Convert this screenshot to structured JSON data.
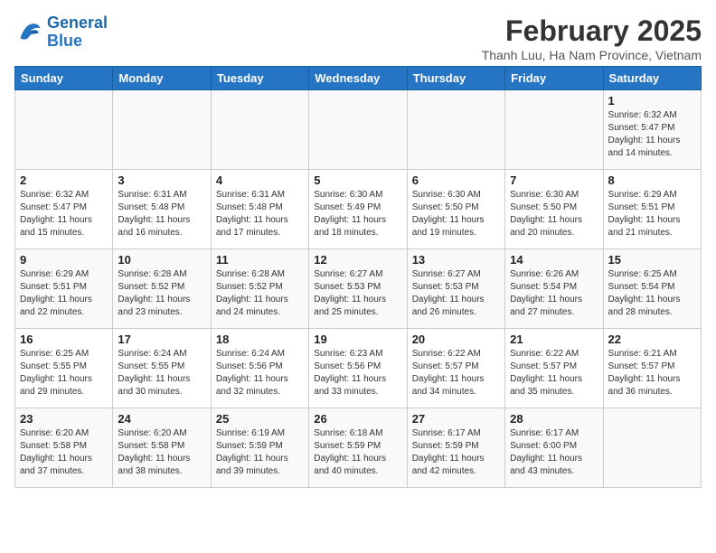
{
  "logo": {
    "line1": "General",
    "line2": "Blue"
  },
  "title": "February 2025",
  "subtitle": "Thanh Luu, Ha Nam Province, Vietnam",
  "days_of_week": [
    "Sunday",
    "Monday",
    "Tuesday",
    "Wednesday",
    "Thursday",
    "Friday",
    "Saturday"
  ],
  "weeks": [
    [
      {
        "day": "",
        "info": ""
      },
      {
        "day": "",
        "info": ""
      },
      {
        "day": "",
        "info": ""
      },
      {
        "day": "",
        "info": ""
      },
      {
        "day": "",
        "info": ""
      },
      {
        "day": "",
        "info": ""
      },
      {
        "day": "1",
        "info": "Sunrise: 6:32 AM\nSunset: 5:47 PM\nDaylight: 11 hours and 14 minutes."
      }
    ],
    [
      {
        "day": "2",
        "info": "Sunrise: 6:32 AM\nSunset: 5:47 PM\nDaylight: 11 hours and 15 minutes."
      },
      {
        "day": "3",
        "info": "Sunrise: 6:31 AM\nSunset: 5:48 PM\nDaylight: 11 hours and 16 minutes."
      },
      {
        "day": "4",
        "info": "Sunrise: 6:31 AM\nSunset: 5:48 PM\nDaylight: 11 hours and 17 minutes."
      },
      {
        "day": "5",
        "info": "Sunrise: 6:30 AM\nSunset: 5:49 PM\nDaylight: 11 hours and 18 minutes."
      },
      {
        "day": "6",
        "info": "Sunrise: 6:30 AM\nSunset: 5:50 PM\nDaylight: 11 hours and 19 minutes."
      },
      {
        "day": "7",
        "info": "Sunrise: 6:30 AM\nSunset: 5:50 PM\nDaylight: 11 hours and 20 minutes."
      },
      {
        "day": "8",
        "info": "Sunrise: 6:29 AM\nSunset: 5:51 PM\nDaylight: 11 hours and 21 minutes."
      }
    ],
    [
      {
        "day": "9",
        "info": "Sunrise: 6:29 AM\nSunset: 5:51 PM\nDaylight: 11 hours and 22 minutes."
      },
      {
        "day": "10",
        "info": "Sunrise: 6:28 AM\nSunset: 5:52 PM\nDaylight: 11 hours and 23 minutes."
      },
      {
        "day": "11",
        "info": "Sunrise: 6:28 AM\nSunset: 5:52 PM\nDaylight: 11 hours and 24 minutes."
      },
      {
        "day": "12",
        "info": "Sunrise: 6:27 AM\nSunset: 5:53 PM\nDaylight: 11 hours and 25 minutes."
      },
      {
        "day": "13",
        "info": "Sunrise: 6:27 AM\nSunset: 5:53 PM\nDaylight: 11 hours and 26 minutes."
      },
      {
        "day": "14",
        "info": "Sunrise: 6:26 AM\nSunset: 5:54 PM\nDaylight: 11 hours and 27 minutes."
      },
      {
        "day": "15",
        "info": "Sunrise: 6:25 AM\nSunset: 5:54 PM\nDaylight: 11 hours and 28 minutes."
      }
    ],
    [
      {
        "day": "16",
        "info": "Sunrise: 6:25 AM\nSunset: 5:55 PM\nDaylight: 11 hours and 29 minutes."
      },
      {
        "day": "17",
        "info": "Sunrise: 6:24 AM\nSunset: 5:55 PM\nDaylight: 11 hours and 30 minutes."
      },
      {
        "day": "18",
        "info": "Sunrise: 6:24 AM\nSunset: 5:56 PM\nDaylight: 11 hours and 32 minutes."
      },
      {
        "day": "19",
        "info": "Sunrise: 6:23 AM\nSunset: 5:56 PM\nDaylight: 11 hours and 33 minutes."
      },
      {
        "day": "20",
        "info": "Sunrise: 6:22 AM\nSunset: 5:57 PM\nDaylight: 11 hours and 34 minutes."
      },
      {
        "day": "21",
        "info": "Sunrise: 6:22 AM\nSunset: 5:57 PM\nDaylight: 11 hours and 35 minutes."
      },
      {
        "day": "22",
        "info": "Sunrise: 6:21 AM\nSunset: 5:57 PM\nDaylight: 11 hours and 36 minutes."
      }
    ],
    [
      {
        "day": "23",
        "info": "Sunrise: 6:20 AM\nSunset: 5:58 PM\nDaylight: 11 hours and 37 minutes."
      },
      {
        "day": "24",
        "info": "Sunrise: 6:20 AM\nSunset: 5:58 PM\nDaylight: 11 hours and 38 minutes."
      },
      {
        "day": "25",
        "info": "Sunrise: 6:19 AM\nSunset: 5:59 PM\nDaylight: 11 hours and 39 minutes."
      },
      {
        "day": "26",
        "info": "Sunrise: 6:18 AM\nSunset: 5:59 PM\nDaylight: 11 hours and 40 minutes."
      },
      {
        "day": "27",
        "info": "Sunrise: 6:17 AM\nSunset: 5:59 PM\nDaylight: 11 hours and 42 minutes."
      },
      {
        "day": "28",
        "info": "Sunrise: 6:17 AM\nSunset: 6:00 PM\nDaylight: 11 hours and 43 minutes."
      },
      {
        "day": "",
        "info": ""
      }
    ]
  ]
}
